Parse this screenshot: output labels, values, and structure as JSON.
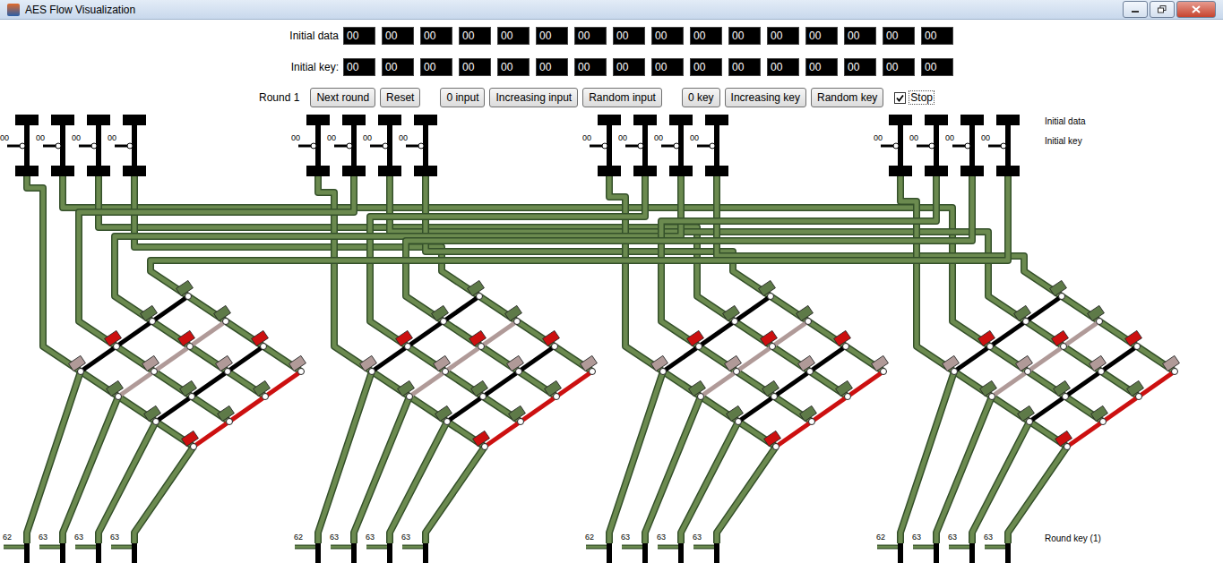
{
  "window": {
    "title": "AES Flow Visualization"
  },
  "fields": [
    {
      "label": "Initial data",
      "bytes": [
        "00",
        "00",
        "00",
        "00",
        "00",
        "00",
        "00",
        "00",
        "00",
        "00",
        "00",
        "00",
        "00",
        "00",
        "00",
        "00"
      ]
    },
    {
      "label": "Initial key:",
      "bytes": [
        "00",
        "00",
        "00",
        "00",
        "00",
        "00",
        "00",
        "00",
        "00",
        "00",
        "00",
        "00",
        "00",
        "00",
        "00",
        "00"
      ]
    }
  ],
  "round": "Round 1",
  "button_groups": [
    [
      "Next round",
      "Reset"
    ],
    [
      "0 input",
      "Increasing input",
      "Random input"
    ],
    [
      "0 key",
      "Increasing key",
      "Random key"
    ]
  ],
  "stop": {
    "label": "Stop",
    "checked": true
  },
  "diagram": {
    "legend": [
      "Initial data",
      "Initial key"
    ],
    "round_key_label": "Round key (1)",
    "columns": [
      {
        "input": "00",
        "output": "62"
      },
      {
        "input": "00",
        "output": "63"
      },
      {
        "input": "00",
        "output": "63"
      },
      {
        "input": "00",
        "output": "63"
      },
      {
        "input": "00",
        "output": "62"
      },
      {
        "input": "00",
        "output": "63"
      },
      {
        "input": "00",
        "output": "63"
      },
      {
        "input": "00",
        "output": "63"
      },
      {
        "input": "00",
        "output": "62"
      },
      {
        "input": "00",
        "output": "63"
      },
      {
        "input": "00",
        "output": "63"
      },
      {
        "input": "00",
        "output": "63"
      },
      {
        "input": "00",
        "output": "62"
      },
      {
        "input": "00",
        "output": "63"
      },
      {
        "input": "00",
        "output": "63"
      },
      {
        "input": "00",
        "output": "63"
      }
    ],
    "gates": [
      {
        "color": "#b09a98"
      },
      {
        "color": "#cc1010"
      },
      {
        "color": "#5e7a48"
      },
      {
        "color": "#5e7a48"
      },
      {
        "color": "#5e7a48"
      },
      {
        "color": "#b09a98"
      },
      {
        "color": "#cc1010"
      },
      {
        "color": "#5e7a48"
      },
      {
        "color": "#5e7a48"
      },
      {
        "color": "#5e7a48"
      },
      {
        "color": "#b09a98"
      },
      {
        "color": "#cc1010"
      },
      {
        "color": "#cc1010"
      },
      {
        "color": "#5e7a48"
      },
      {
        "color": "#5e7a48"
      },
      {
        "color": "#b09a98"
      }
    ],
    "output_lines": [
      {
        "color": "#000000"
      },
      {
        "color": "#b09a98"
      },
      {
        "color": "#000000"
      },
      {
        "color": "#cc1010"
      }
    ]
  }
}
